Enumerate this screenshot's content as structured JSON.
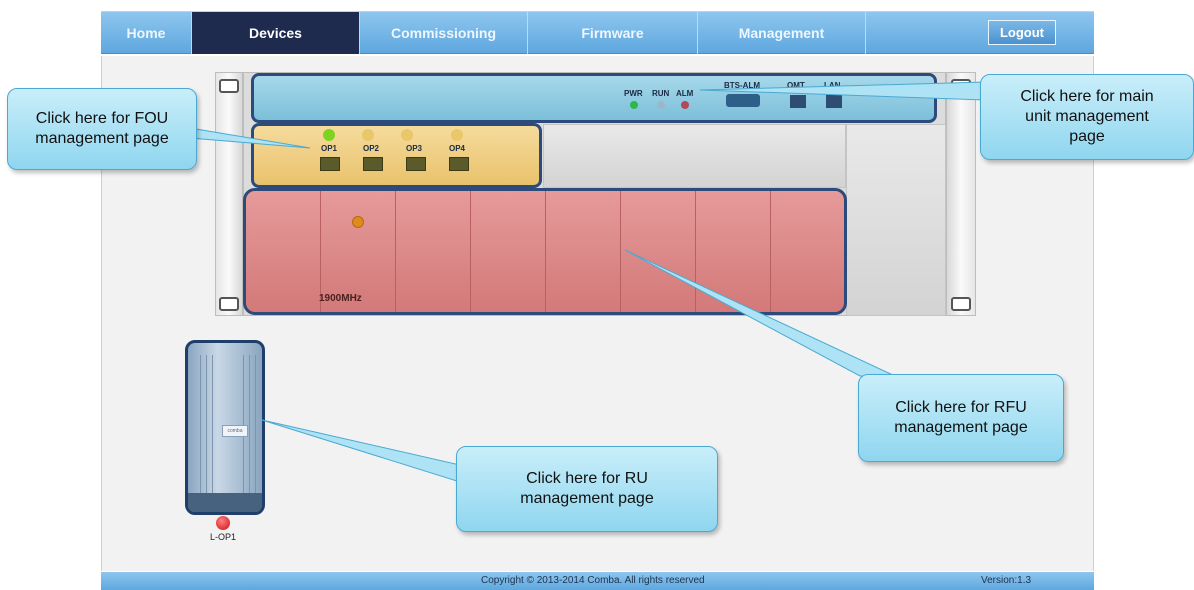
{
  "nav": {
    "tabs": [
      {
        "label": "Home"
      },
      {
        "label": "Devices"
      },
      {
        "label": "Commissioning"
      },
      {
        "label": "Firmware"
      },
      {
        "label": "Management"
      }
    ],
    "active_tab": "Devices",
    "logout_label": "Logout"
  },
  "main_unit": {
    "leds": [
      {
        "label": "PWR",
        "color": "#2db84a"
      },
      {
        "label": "RUN",
        "color": "#9ab8c8"
      },
      {
        "label": "ALM",
        "color": "#b04a5a"
      }
    ],
    "ports": [
      "BTS-ALM",
      "OMT",
      "LAN"
    ]
  },
  "fou": {
    "ports": [
      {
        "label": "OP1",
        "led_color": "#7ed321"
      },
      {
        "label": "OP2",
        "led_color": "#e8c86a"
      },
      {
        "label": "OP3",
        "led_color": "#e8c86a"
      },
      {
        "label": "OP4",
        "led_color": "#e8c86a"
      }
    ]
  },
  "rfu": {
    "slots": 8,
    "band_label": "1900MHz",
    "led_color": "#e08a1e"
  },
  "ru": {
    "badge": "comba",
    "label": "L-OP1",
    "led_color": "#cc1010"
  },
  "callouts": {
    "fou": "Click here for FOU\nmanagement page",
    "main": "Click here for main\nunit management\npage",
    "rfu": "Click here for RFU\nmanagement page",
    "ru": "Click here for RU\nmanagement page"
  },
  "footer": {
    "copyright": "Copyright © 2013-2014 Comba. All rights reserved",
    "version": "Version:1.3"
  }
}
